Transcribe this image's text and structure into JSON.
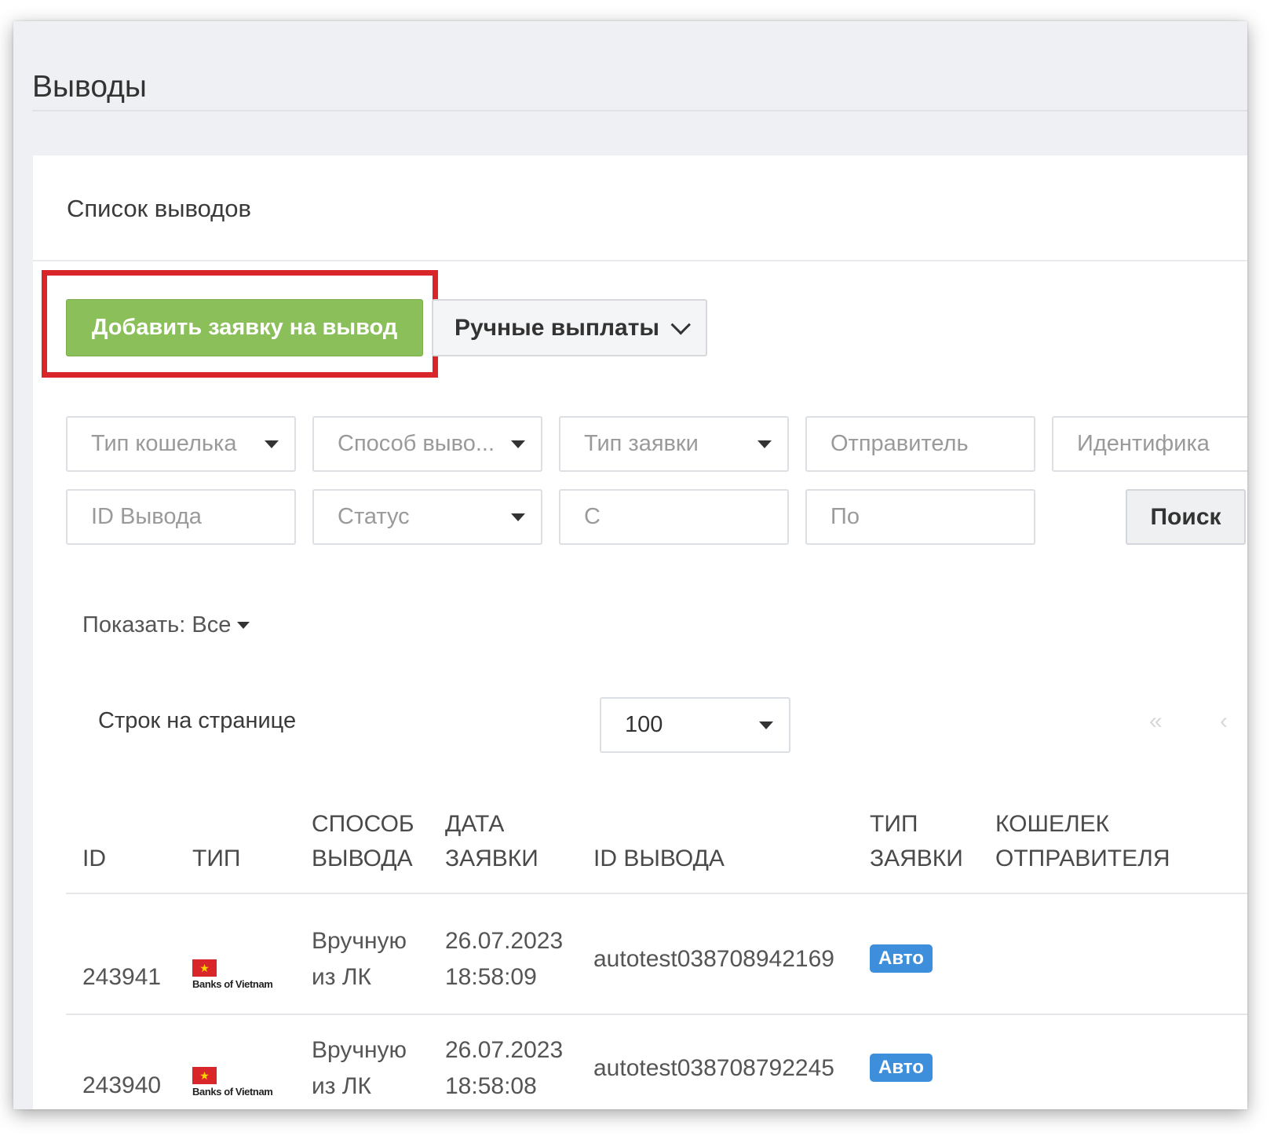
{
  "page": {
    "title": "Выводы"
  },
  "card": {
    "title": "Список выводов"
  },
  "actions": {
    "add_label": "Добавить заявку на вывод",
    "manual_label": "Ручные выплаты"
  },
  "filters": {
    "wallet_type": "Тип кошелька",
    "withdraw_method": "Способ выво...",
    "request_type": "Тип заявки",
    "sender": "Отправитель",
    "identifier": "Идентифика",
    "withdraw_id": "ID Вывода",
    "status": "Статус",
    "date_from": "С",
    "date_to": "По",
    "search_label": "Поиск"
  },
  "show_filter": {
    "label": "Показать: Все"
  },
  "pagination": {
    "rows_label": "Строк на странице",
    "rows_value": "100",
    "first": "«",
    "prev": "‹"
  },
  "table": {
    "headers": {
      "id": "ID",
      "type": "ТИП",
      "method_1": "СПОСОБ",
      "method_2": "ВЫВОДА",
      "date_1": "ДАТА",
      "date_2": "ЗАЯВКИ",
      "withdraw_id": "ID ВЫВОДА",
      "req_type_1": "ТИП",
      "req_type_2": "ЗАЯВКИ",
      "wallet_1": "КОШЕЛЕК",
      "wallet_2": "ОТПРАВИТЕЛЯ"
    },
    "rows": [
      {
        "id": "243941",
        "bank_name": "Banks of Vietnam",
        "method_1": "Вручную",
        "method_2": "из ЛК",
        "date": "26.07.2023",
        "time": "18:58:09",
        "withdraw_id": "autotest038708942169",
        "req_type": "Авто"
      },
      {
        "id": "243940",
        "bank_name": "Banks of Vietnam",
        "method_1": "Вручную",
        "method_2": "из ЛК",
        "date": "26.07.2023",
        "time": "18:58:08",
        "withdraw_id": "autotest038708792245",
        "req_type": "Авто"
      }
    ]
  },
  "colors": {
    "add_button": "#8bbf5a",
    "highlight": "#d8262a",
    "badge": "#3d8fdc"
  },
  "icons": {
    "bank": "vietnam-flag-bank-logo",
    "caret": "caret-down-icon",
    "chevron": "chevron-down-icon"
  }
}
